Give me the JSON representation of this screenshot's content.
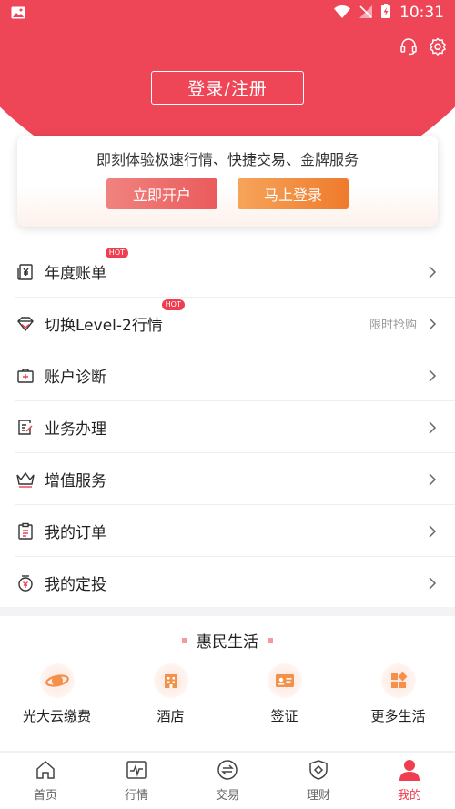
{
  "status_bar": {
    "time": "10:31"
  },
  "header": {
    "login_register": "登录/注册",
    "icons": [
      "headset-icon",
      "gear-icon"
    ]
  },
  "promo": {
    "text": "即刻体验极速行情、快捷交易、金牌服务",
    "open_account": "立即开户",
    "login_now": "马上登录"
  },
  "menu": {
    "items": [
      {
        "label": "年度账单",
        "badge": "HOT",
        "icon": "bill-icon"
      },
      {
        "label": "切换Level-2行情",
        "badge": "HOT",
        "extra": "限时抢购",
        "icon": "diamond-icon"
      },
      {
        "label": "账户诊断",
        "icon": "medical-kit-icon"
      },
      {
        "label": "业务办理",
        "icon": "document-edit-icon"
      },
      {
        "label": "增值服务",
        "icon": "crown-icon"
      },
      {
        "label": "我的订单",
        "icon": "clipboard-icon"
      },
      {
        "label": "我的定投",
        "icon": "fixed-investment-icon"
      }
    ]
  },
  "life": {
    "title": "惠民生活",
    "items": [
      {
        "label": "光大云缴费",
        "icon": "planet-icon"
      },
      {
        "label": "酒店",
        "icon": "hotel-icon"
      },
      {
        "label": "签证",
        "icon": "id-card-icon"
      },
      {
        "label": "更多生活",
        "icon": "apps-icon"
      }
    ]
  },
  "tabs": [
    {
      "label": "首页",
      "icon": "home-icon"
    },
    {
      "label": "行情",
      "icon": "chart-icon"
    },
    {
      "label": "交易",
      "icon": "exchange-icon"
    },
    {
      "label": "理财",
      "icon": "shield-icon"
    },
    {
      "label": "我的",
      "icon": "person-icon",
      "active": true
    }
  ],
  "colors": {
    "brand_red": "#ee4657",
    "accent_orange": "#ef7b2c",
    "badge_red": "#ee3e4f"
  }
}
